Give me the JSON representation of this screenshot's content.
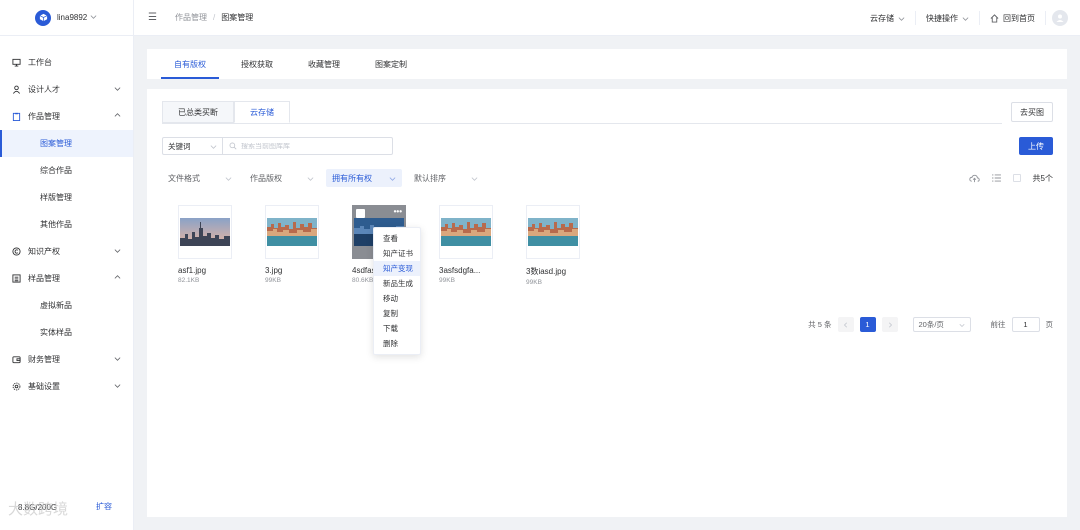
{
  "user": {
    "name": "lina9892"
  },
  "sidebar": {
    "items": [
      {
        "label": "工作台",
        "icon": "monitor-icon",
        "chevron": ""
      },
      {
        "label": "设计人才",
        "icon": "user-icon",
        "chevron": "down"
      },
      {
        "label": "作品管理",
        "icon": "clipboard-icon",
        "chevron": "up"
      },
      {
        "label": "图案管理",
        "sub": true,
        "active": true
      },
      {
        "label": "综合作品",
        "sub": true
      },
      {
        "label": "样版管理",
        "sub": true
      },
      {
        "label": "其他作品",
        "sub": true
      },
      {
        "label": "知识产权",
        "icon": "copyright-icon",
        "chevron": "down"
      },
      {
        "label": "样品管理",
        "icon": "list-icon",
        "chevron": "up"
      },
      {
        "label": "虚拟新品",
        "sub": true
      },
      {
        "label": "实体样品",
        "sub": true
      },
      {
        "label": "财务管理",
        "icon": "wallet-icon",
        "chevron": "down"
      },
      {
        "label": "基础设置",
        "icon": "gear-icon",
        "chevron": "down"
      }
    ],
    "storage": "8.8G/200G",
    "expand": "扩容"
  },
  "header": {
    "crumb_parent": "作品管理",
    "crumb_sep": "/",
    "crumb_current": "图案管理",
    "cloud": "云存储",
    "quick": "快捷操作",
    "home": "回到首页"
  },
  "tabs": [
    "自有版权",
    "授权获取",
    "收藏管理",
    "图案定制"
  ],
  "subtabs": [
    "已总类买断",
    "云存储"
  ],
  "buy_button": "去买图",
  "search": {
    "keyword_select": "关键词",
    "placeholder": "搜索当前图库库"
  },
  "upload_button": "上传",
  "filters": [
    "文件格式",
    "作品版权",
    "拥有所有权",
    "默认排序"
  ],
  "total_label": "共5个",
  "files": [
    {
      "name": "asf1.jpg",
      "size": "82.1KB",
      "img": "city"
    },
    {
      "name": "3.jpg",
      "size": "99KB",
      "img": "harbor"
    },
    {
      "name": "4sdfas",
      "size": "80.6KB",
      "img": "blue"
    },
    {
      "name": "3asfsdgfa...",
      "size": "99KB",
      "img": "harbor"
    },
    {
      "name": "3数iasd.jpg",
      "size": "99KB",
      "img": "harbor"
    }
  ],
  "context_menu": [
    "查看",
    "知产证书",
    "知产变现",
    "新品生成",
    "移动",
    "复制",
    "下载",
    "删除"
  ],
  "pagination": {
    "total": "共 5 条",
    "current": "1",
    "page_size": "20条/页",
    "goto_label": "前往",
    "goto_value": "1",
    "page_suffix": "页"
  },
  "watermark": "大数跨境",
  "colors": {
    "accent": "#2a5bd7",
    "bg": "#f0f2f5"
  }
}
